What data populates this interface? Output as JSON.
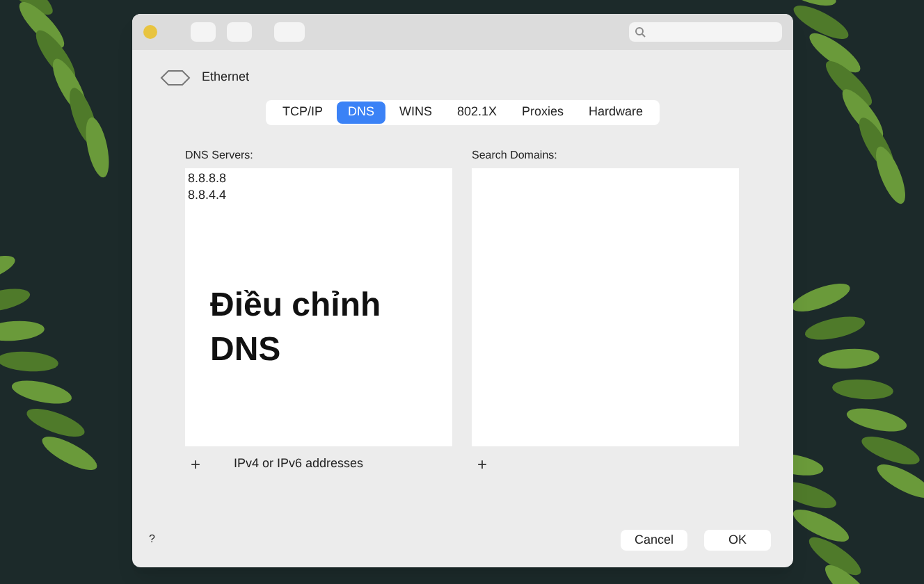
{
  "window": {
    "header": "Ethernet"
  },
  "tabs": [
    {
      "label": "TCP/IP",
      "selected": false
    },
    {
      "label": "DNS",
      "selected": true
    },
    {
      "label": "WINS",
      "selected": false
    },
    {
      "label": "802.1X",
      "selected": false
    },
    {
      "label": "Proxies",
      "selected": false
    },
    {
      "label": "Hardware",
      "selected": false
    }
  ],
  "dns_servers": {
    "label": "DNS Servers:",
    "entries": [
      "8.8.8.8",
      "8.8.4.4"
    ],
    "add": "+",
    "hint": "IPv4 or IPv6 addresses"
  },
  "search_domains": {
    "label": "Search Domains:",
    "add": "+"
  },
  "caption": [
    "Điều chỉnh",
    "DNS"
  ],
  "help": "?",
  "buttons": [
    "Cancel",
    "OK"
  ]
}
